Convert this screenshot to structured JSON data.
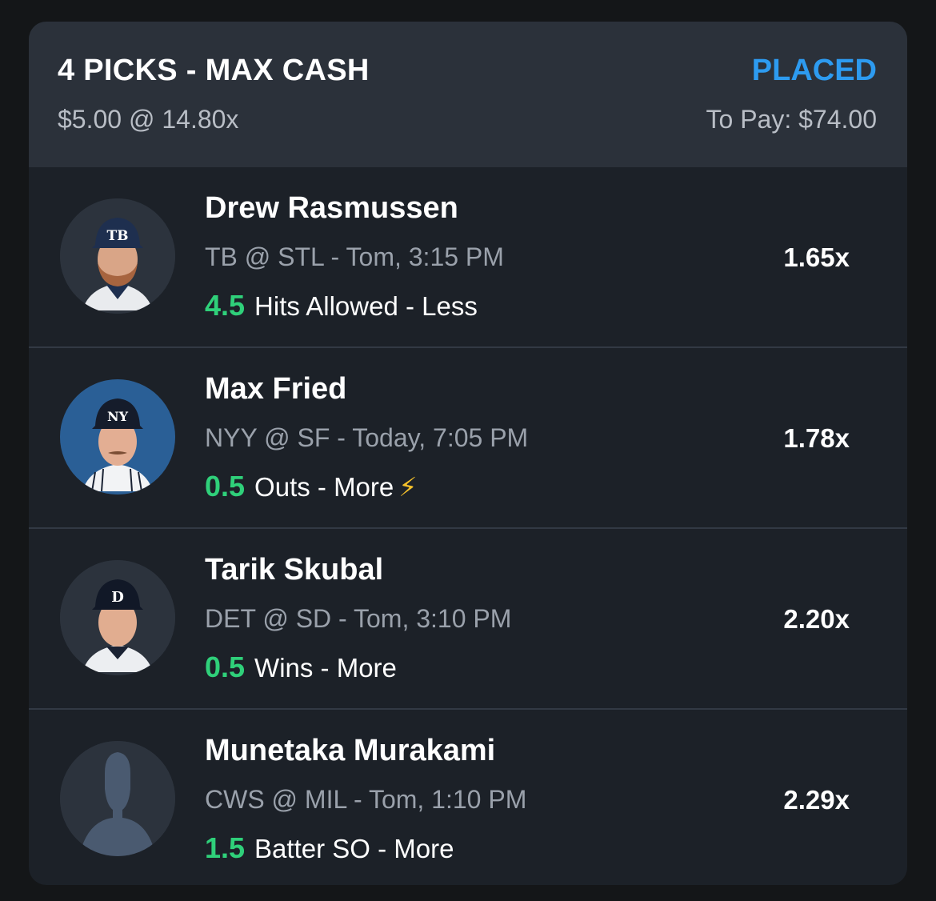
{
  "header": {
    "title": "4 PICKS - MAX CASH",
    "status": "PLACED",
    "stake": "$5.00 @ 14.80x",
    "to_pay": "To Pay: $74.00"
  },
  "picks": [
    {
      "player": "Drew Rasmussen",
      "game": "TB @ STL",
      "time": "- Tom, 3:15 PM",
      "line_value": "4.5",
      "stat": "Hits Allowed - Less",
      "multiplier": "1.65x",
      "cap_logo": "TB",
      "avatar": "player-photo"
    },
    {
      "player": "Max Fried",
      "game": "NYY @ SF",
      "time": "- Today, 7:05 PM",
      "line_value": "0.5",
      "stat": "Outs - More",
      "badge_icon": "lightning-icon",
      "multiplier": "1.78x",
      "cap_logo": "NY",
      "avatar": "player-photo"
    },
    {
      "player": "Tarik Skubal",
      "game": "DET @ SD",
      "time": "- Tom, 3:10 PM",
      "line_value": "0.5",
      "stat": "Wins - More",
      "multiplier": "2.20x",
      "cap_logo": "D",
      "avatar": "player-photo"
    },
    {
      "player": "Munetaka Murakami",
      "game": "CWS @ MIL",
      "time": "- Tom, 1:10 PM",
      "line_value": "1.5",
      "stat": "Batter SO - More",
      "multiplier": "2.29x",
      "avatar": "placeholder-silhouette"
    }
  ],
  "colors": {
    "accent": "#2d9bf0",
    "line_value": "#2fd07a",
    "card_bg": "#1c2128",
    "header_bg": "#2b313a"
  }
}
